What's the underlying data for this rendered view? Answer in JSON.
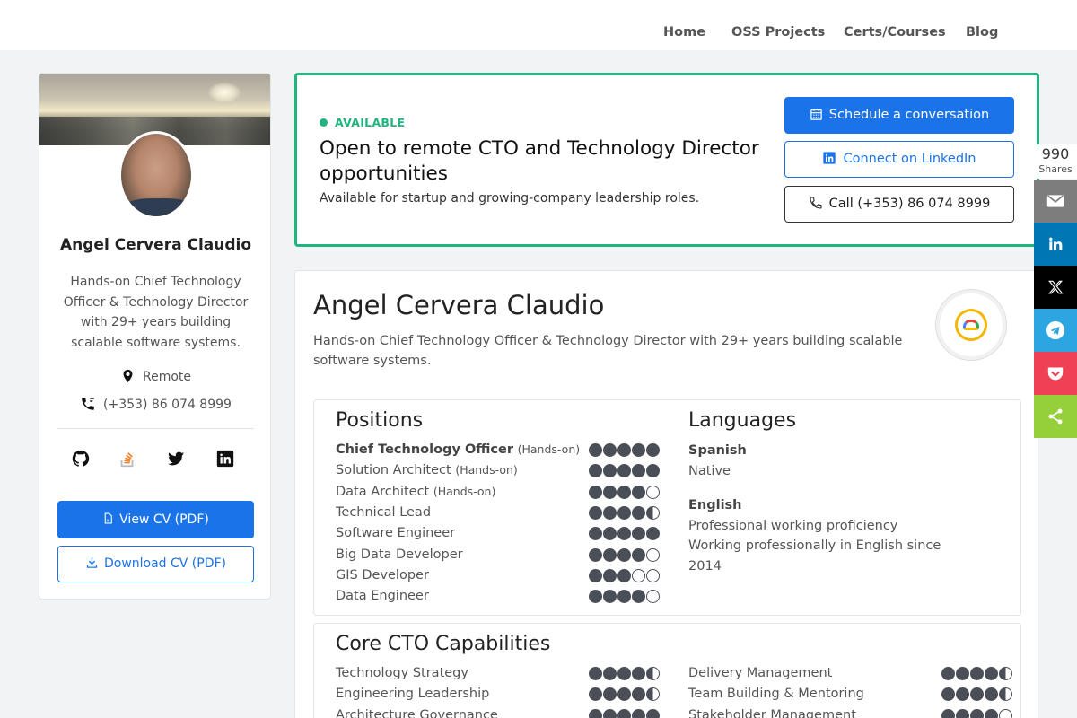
{
  "nav": {
    "items": [
      "Home",
      "OSS Projects",
      "Certs/Courses",
      "Blog"
    ]
  },
  "sidebar": {
    "name": "Angel Cervera Claudio",
    "bio": "Hands-on Chief Technology Officer & Technology Director with 29+ years building scalable software systems.",
    "location": "Remote",
    "phone": "(+353) 86 074 8999",
    "social_icons": [
      "github-icon",
      "stackoverflow-icon",
      "twitter-icon",
      "linkedin-icon"
    ],
    "view_cv": "View CV (PDF)",
    "download_cv": "Download CV (PDF)"
  },
  "availability": {
    "status": "AVAILABLE",
    "headline": "Open to remote CTO and Technology Director opportunities",
    "sub": "Available for startup and growing-company leadership roles.",
    "schedule": "Schedule a conversation",
    "linkedin": "Connect on LinkedIn",
    "call": "Call (+353) 86 074 8999"
  },
  "profile": {
    "title": "Angel Cervera Claudio",
    "subtitle": "Hands-on Chief Technology Officer & Technology Director with 29+ years building scalable software systems."
  },
  "positions": {
    "heading": "Positions",
    "items": [
      {
        "name": "Chief Technology Officer",
        "note": "(Hands-on)",
        "rating": 5,
        "bold": true
      },
      {
        "name": "Solution Architect",
        "note": "(Hands-on)",
        "rating": 5
      },
      {
        "name": "Data Architect",
        "note": "(Hands-on)",
        "rating": 4
      },
      {
        "name": "Technical Lead",
        "note": "",
        "rating": 4.5
      },
      {
        "name": "Software Engineer",
        "note": "",
        "rating": 5
      },
      {
        "name": "Big Data Developer",
        "note": "",
        "rating": 4
      },
      {
        "name": "GIS Developer",
        "note": "",
        "rating": 3
      },
      {
        "name": "Data Engineer",
        "note": "",
        "rating": 4
      }
    ]
  },
  "languages": {
    "heading": "Languages",
    "spanish": {
      "name": "Spanish",
      "level": "Native"
    },
    "english": {
      "name": "English",
      "level": "Professional working proficiency",
      "note": "Working professionally in English since 2014"
    }
  },
  "capabilities": {
    "heading": "Core CTO Capabilities",
    "left": [
      {
        "name": "Technology Strategy",
        "rating": 4.5
      },
      {
        "name": "Engineering Leadership",
        "rating": 4.5
      },
      {
        "name": "Architecture Governance",
        "rating": 5
      }
    ],
    "right": [
      {
        "name": "Delivery Management",
        "rating": 4.5
      },
      {
        "name": "Team Building & Mentoring",
        "rating": 4.5
      },
      {
        "name": "Stakeholder Management",
        "rating": 4
      }
    ]
  },
  "share": {
    "count": "990",
    "label": "Shares"
  },
  "colors": {
    "accent": "#1a73e8",
    "available": "#1fb57e",
    "email": "#7d7d7d",
    "linkedin": "#0077b5",
    "x": "#000000",
    "telegram": "#2ca5e0",
    "pocket": "#ef4056",
    "share": "#95d03a"
  }
}
